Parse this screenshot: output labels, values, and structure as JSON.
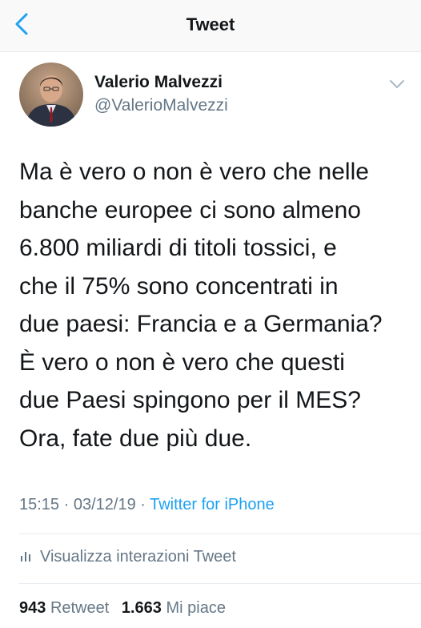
{
  "header": {
    "title": "Tweet",
    "back_icon": "chevron-left-icon"
  },
  "author": {
    "name": "Valerio Malvezzi",
    "handle": "@ValerioMalvezzi"
  },
  "tweet": {
    "text": "Ma è vero o non è vero che nelle\nbanche europee ci sono almeno\n6.800 miliardi di titoli tossici, e\nche il 75% sono concentrati in\ndue paesi: Francia e a Germania?\nÈ vero o non è vero che questi\ndue Paesi spingono per il MES?\nOra, fate due più due."
  },
  "meta": {
    "time": "15:15",
    "separator": " · ",
    "date": "03/12/19",
    "source": "Twitter for iPhone"
  },
  "analytics": {
    "label": "Visualizza interazioni Tweet"
  },
  "stats": {
    "retweets_count": "943",
    "retweets_label": "Retweet",
    "likes_count": "1.663",
    "likes_label": "Mi piace"
  },
  "colors": {
    "accent": "#1da1f2",
    "text": "#14171a",
    "secondary": "#657786",
    "divider": "#e6ecf0"
  }
}
